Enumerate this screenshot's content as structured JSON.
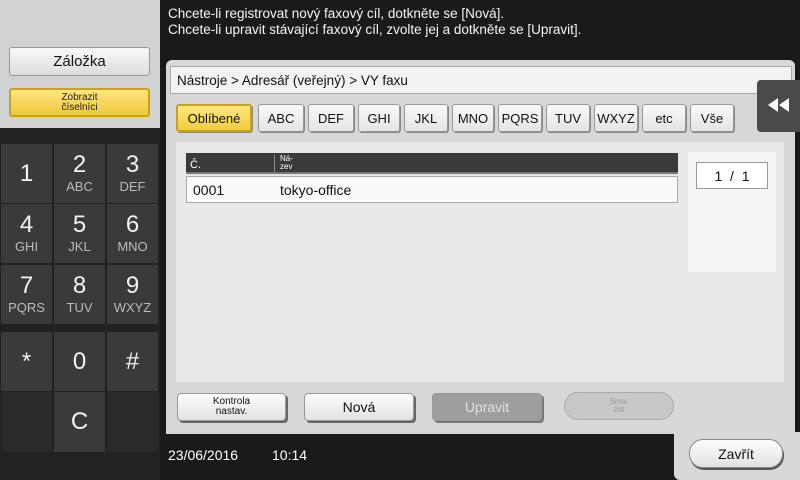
{
  "header": {
    "message_line1": "Chcete-li registrovat nový faxový cíl, dotkněte se [Nová].",
    "message_line2": "Chcete-li upravit stávající faxový cíl, zvolte jej a dotkněte se [Upravit]."
  },
  "left_panel": {
    "bookmark_label": "Záložka",
    "keypad_label_line1": "Zobrazit",
    "keypad_label_line2": "číselníci"
  },
  "keypad": {
    "keys": [
      {
        "num": "1",
        "sub": ""
      },
      {
        "num": "2",
        "sub": "ABC"
      },
      {
        "num": "3",
        "sub": "DEF"
      },
      {
        "num": "4",
        "sub": "GHI"
      },
      {
        "num": "5",
        "sub": "JKL"
      },
      {
        "num": "6",
        "sub": "MNO"
      },
      {
        "num": "7",
        "sub": "PQRS"
      },
      {
        "num": "8",
        "sub": "TUV"
      },
      {
        "num": "9",
        "sub": "WXYZ"
      },
      {
        "num": "*",
        "sub": ""
      },
      {
        "num": "0",
        "sub": ""
      },
      {
        "num": "#",
        "sub": ""
      },
      {
        "num": "",
        "sub": ""
      },
      {
        "num": "C",
        "sub": ""
      },
      {
        "num": "",
        "sub": ""
      }
    ]
  },
  "breadcrumb": "Nástroje > Adresář (veřejný) > VY faxu",
  "tabs": [
    "Oblíbené",
    "ABC",
    "DEF",
    "GHI",
    "JKL",
    "MNO",
    "PQRS",
    "TUV",
    "WXYZ",
    "etc",
    "Vše"
  ],
  "active_tab": "Oblíbené",
  "list": {
    "col_no": "Č.",
    "col_name_line1": "Ná-",
    "col_name_line2": "zev",
    "rows": [
      {
        "no": "0001",
        "name": "tokyo-office"
      }
    ]
  },
  "pager": "1  /  1",
  "actions": {
    "check_settings_line1": "Kontrola",
    "check_settings_line2": "nastav.",
    "new_label": "Nová",
    "edit_label": "Upravit",
    "delete_line1": "Sma-",
    "delete_line2": "zat"
  },
  "status": {
    "date": "23/06/2016",
    "time": "10:14"
  },
  "close_label": "Zavřít",
  "icons": {
    "collapse": "double-chevron-left-icon"
  },
  "colors": {
    "accent_yellow": "#f2cc3c",
    "dark_bg": "#1a1a1a",
    "panel_gray": "#d8d8d8"
  }
}
